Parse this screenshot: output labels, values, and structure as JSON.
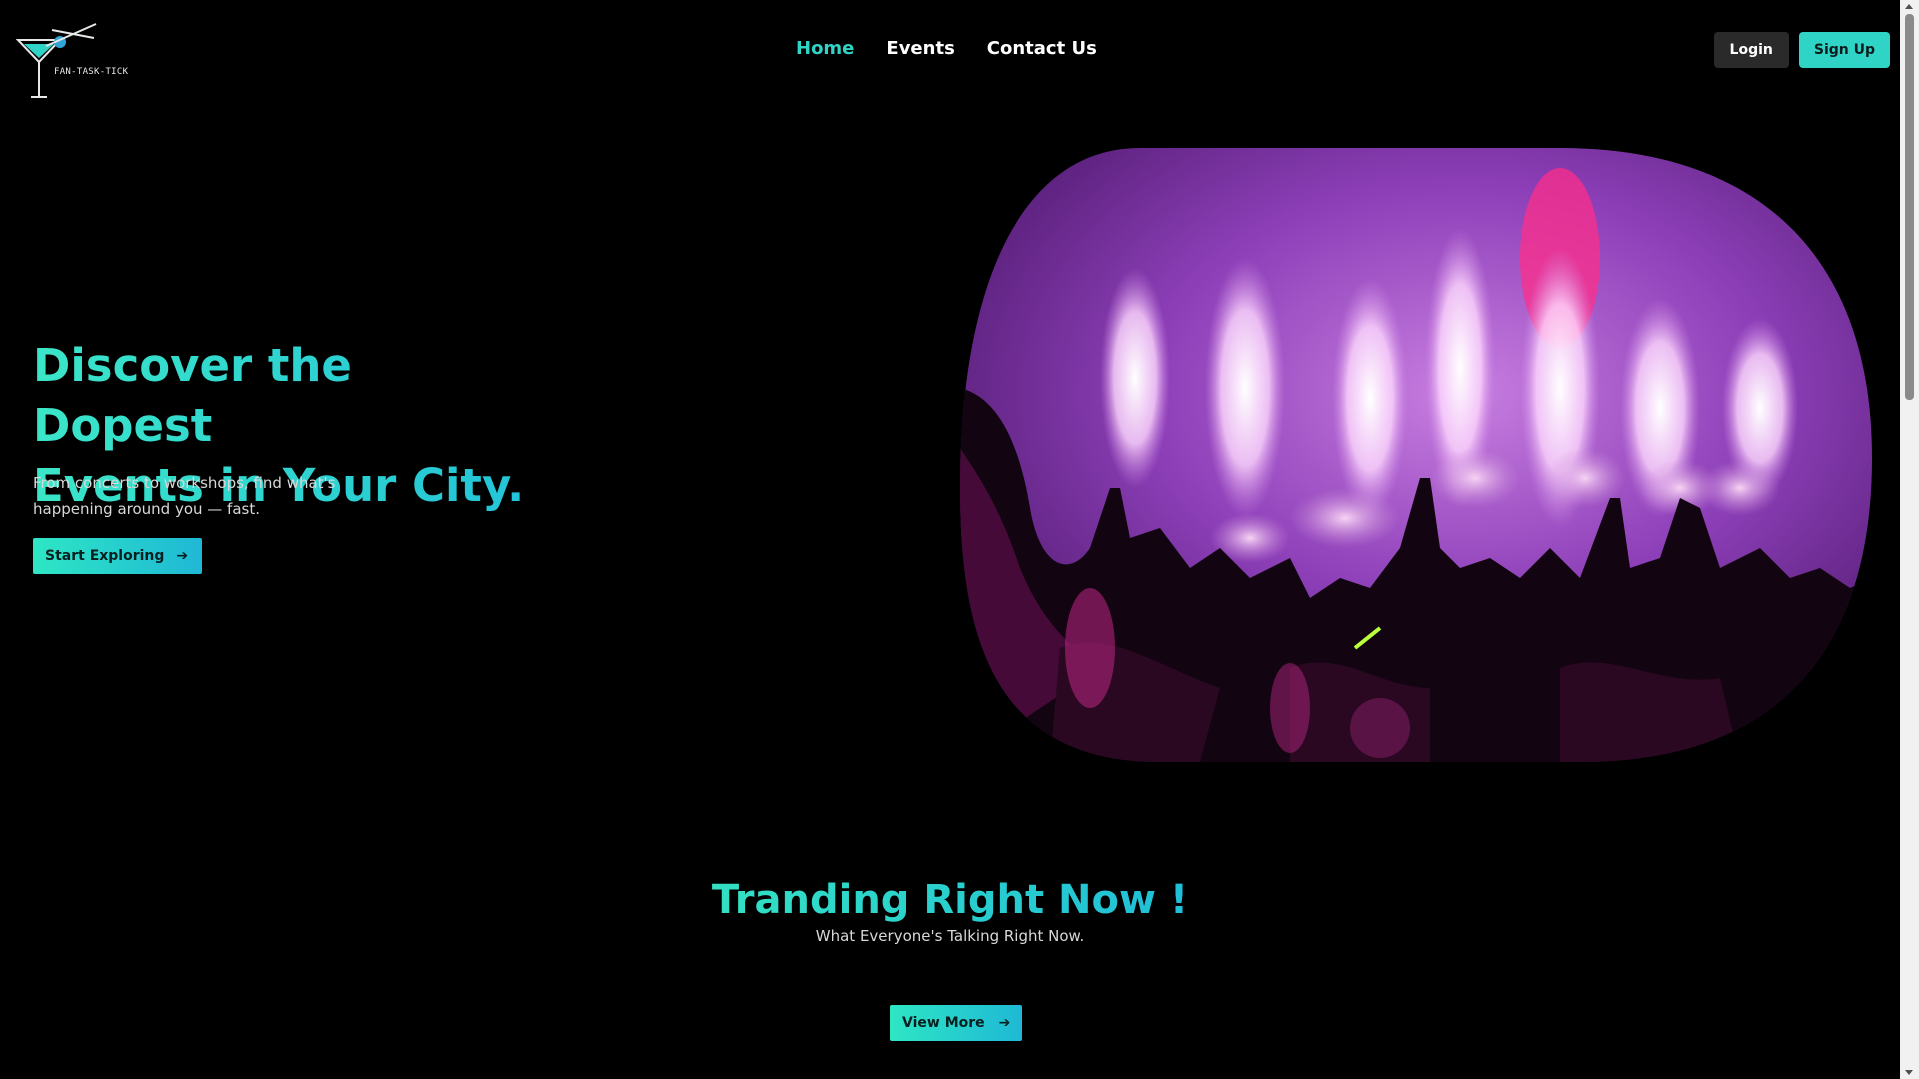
{
  "brand": {
    "logo_text": "FAN-TASK-TICK"
  },
  "nav": {
    "links": [
      "Home",
      "Events",
      "Contact Us"
    ],
    "active": "Home"
  },
  "auth": {
    "login_label": "Login",
    "signup_label": "Sign Up"
  },
  "hero": {
    "title_line1": "Discover the Dopest",
    "title_line2": "Events in Your City.",
    "subtitle": "From concerts to workshops, find what's happening around you — fast.",
    "cta_label": "Start Exploring"
  },
  "trending": {
    "title": "Tranding Right Now !",
    "subtitle": "What Everyone's Talking Right Now.",
    "cta_label": "View More"
  },
  "colors": {
    "accent": "#2fd4c6",
    "background": "#000000",
    "button_dark": "#2a2a2a"
  },
  "icons": {
    "logo": "martini-glass-icon",
    "cta_arrow": "arrow-right-icon"
  }
}
